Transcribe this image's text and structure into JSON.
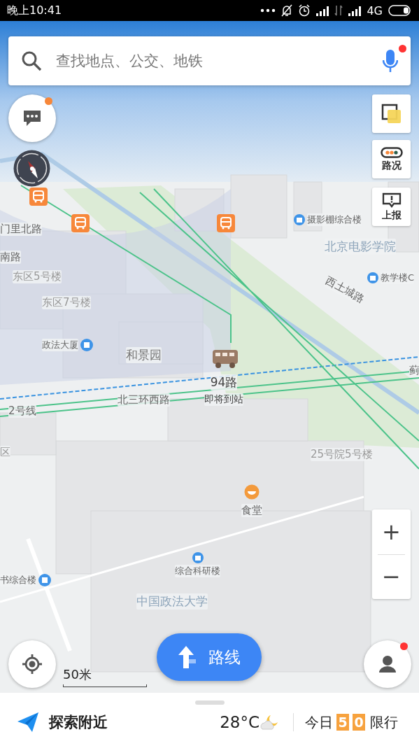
{
  "status_bar": {
    "time": "晚上10:41",
    "network": "4G"
  },
  "search": {
    "placeholder": "查找地点、公交、地铁",
    "mic_badge": true
  },
  "left_controls": {
    "message_badge": true
  },
  "right_controls": [
    {
      "kind": "layers"
    },
    {
      "kind": "traffic",
      "label": "路况"
    },
    {
      "kind": "report",
      "label": "上报"
    }
  ],
  "zoom": {
    "in": "+",
    "out": "−"
  },
  "map_labels": [
    {
      "text": "摄影棚综合楼",
      "kind": "poi"
    },
    {
      "text": "门里北路",
      "kind": "road"
    },
    {
      "text": "北京电影学院",
      "kind": "area"
    },
    {
      "text": "南路",
      "kind": "road"
    },
    {
      "text": "东区5号楼",
      "kind": "building"
    },
    {
      "text": "教学楼C",
      "kind": "poi"
    },
    {
      "text": "西土城路",
      "kind": "road"
    },
    {
      "text": "东区7号楼",
      "kind": "building"
    },
    {
      "text": "政法大厦",
      "kind": "poi"
    },
    {
      "text": "和景园",
      "kind": "place"
    },
    {
      "text": "蓟",
      "kind": "road"
    },
    {
      "text": "北三环西路",
      "kind": "road"
    },
    {
      "text": "2号线",
      "kind": "road"
    },
    {
      "text": "区",
      "kind": "building"
    },
    {
      "text": "25号院5号楼",
      "kind": "building"
    },
    {
      "text": "食堂",
      "kind": "food"
    },
    {
      "text": "综合科研楼",
      "kind": "poi"
    },
    {
      "text": "书综合楼",
      "kind": "poi"
    },
    {
      "text": "中国政法大学",
      "kind": "area"
    }
  ],
  "bus": {
    "route": "94路",
    "status": "即将到站"
  },
  "scale": "50米",
  "route_button": "路线",
  "profile": {
    "badge": true
  },
  "bottom_bar": {
    "explore": "探索附近",
    "temperature": "28°C",
    "restriction": {
      "prefix": "今日",
      "digits": [
        "5",
        "0"
      ],
      "suffix": "限行"
    }
  }
}
